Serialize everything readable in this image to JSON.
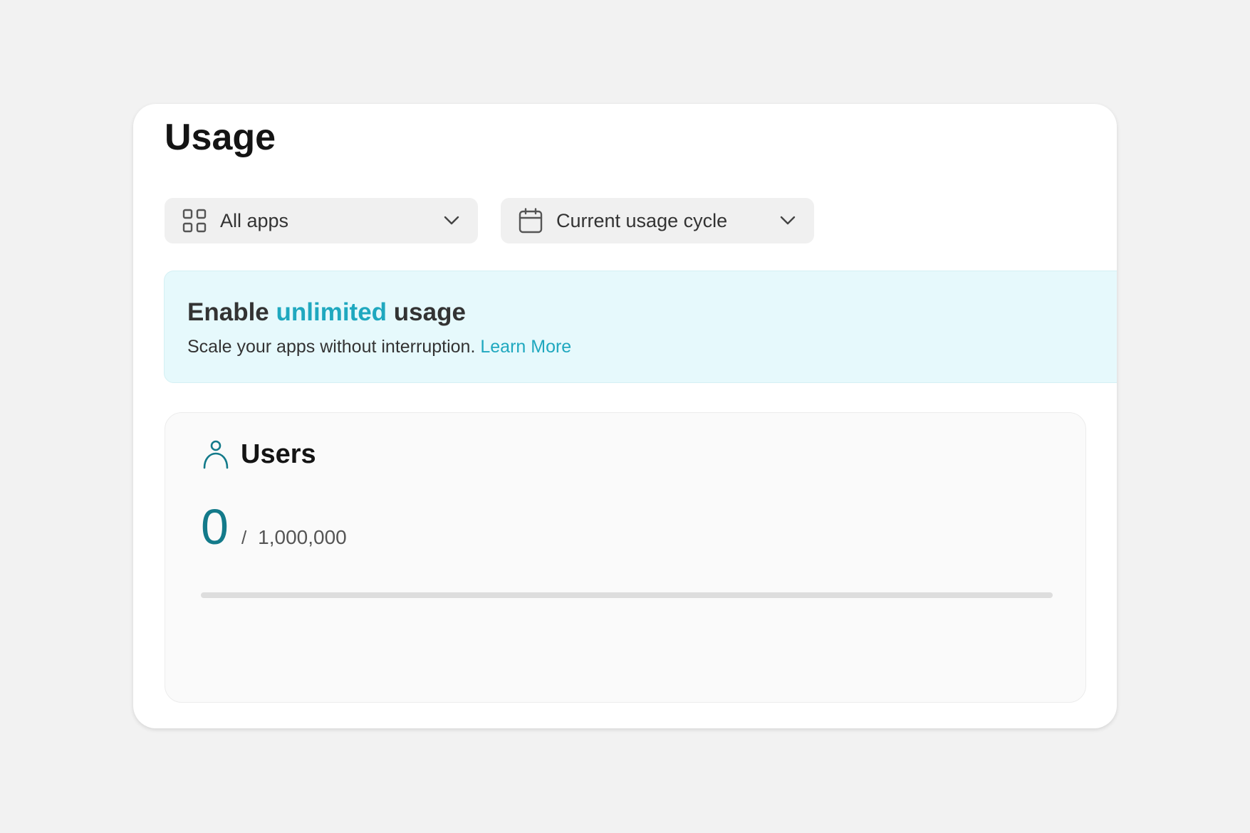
{
  "page": {
    "title": "Usage"
  },
  "filters": {
    "apps": {
      "label": "All apps",
      "icon": "grid-icon"
    },
    "cycle": {
      "label": "Current usage cycle",
      "icon": "calendar-icon"
    }
  },
  "banner": {
    "heading_prefix": "Enable",
    "heading_accent": "unlimited",
    "heading_suffix": "usage",
    "text": "Scale your apps without interruption.",
    "link_label": "Learn More"
  },
  "users": {
    "title": "Users",
    "icon": "user-icon",
    "current": "0",
    "separator": "/",
    "limit": "1,000,000",
    "progress_fraction": 0
  },
  "colors": {
    "accent": "#1fa8bf",
    "value": "#137a8a",
    "banner_bg": "#e6f9fc",
    "track": "#dddddd"
  }
}
